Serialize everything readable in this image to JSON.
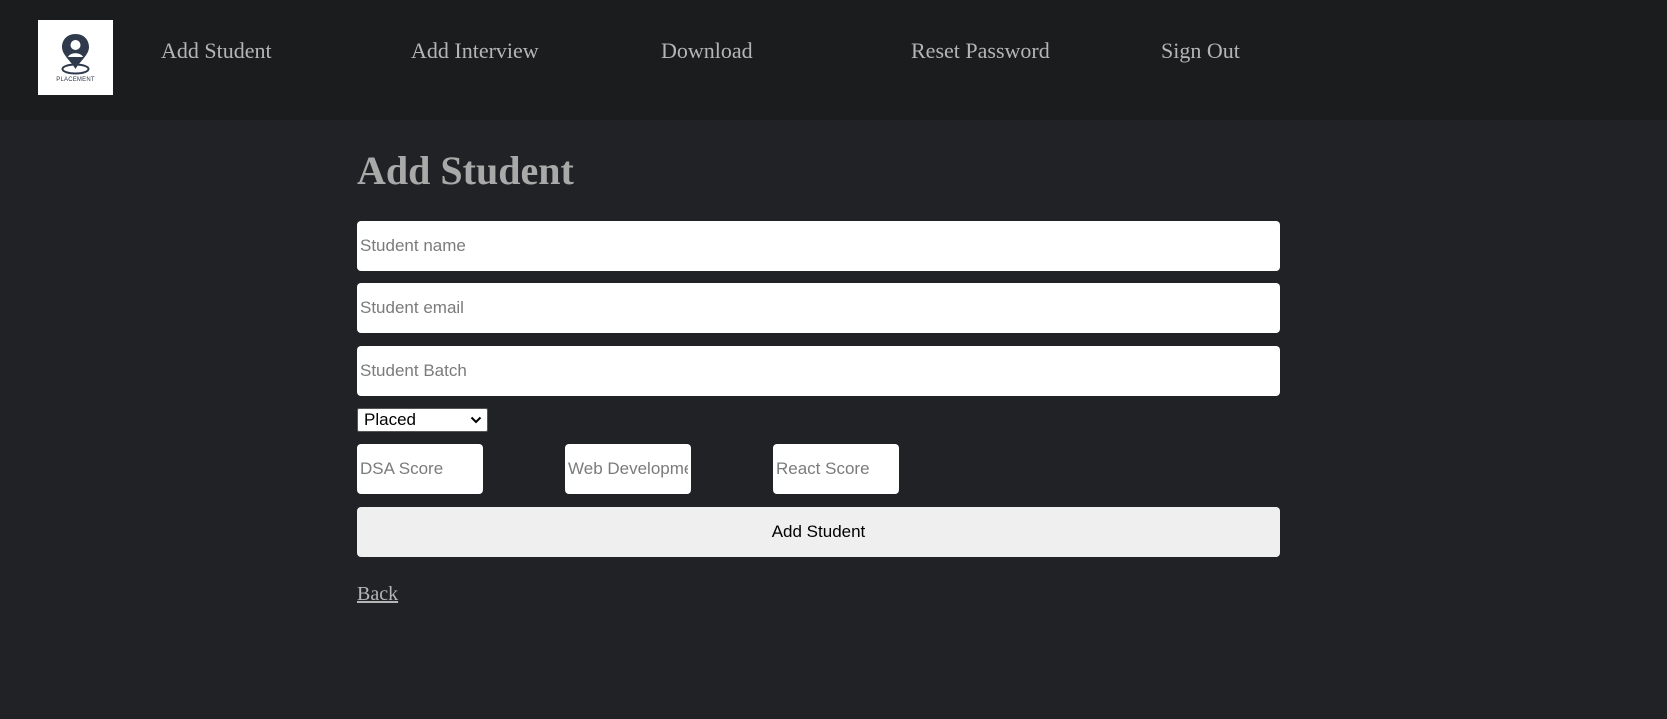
{
  "nav": {
    "logo_text": "PLACEMENT",
    "links": {
      "add_student": "Add Student",
      "add_interview": "Add Interview",
      "download": "Download",
      "reset_password": "Reset Password",
      "sign_out": "Sign Out"
    }
  },
  "form": {
    "title": "Add Student",
    "student_name_placeholder": "Student name",
    "student_email_placeholder": "Student email",
    "student_batch_placeholder": "Student Batch",
    "status_selected": "Placed",
    "dsa_score_placeholder": "DSA Score",
    "web_dev_placeholder": "Web Development Score",
    "react_score_placeholder": "React Score",
    "submit_label": "Add Student",
    "back_label": "Back"
  },
  "icons": {
    "logo": "placement-logo-icon",
    "status_dropdown": "chevron-down-icon"
  },
  "colors": {
    "background": "#212226",
    "navbar": "#1b1c1e",
    "nav_text": "#b5b5b5",
    "title_text": "#a9a9a9",
    "button": "#efefef"
  }
}
